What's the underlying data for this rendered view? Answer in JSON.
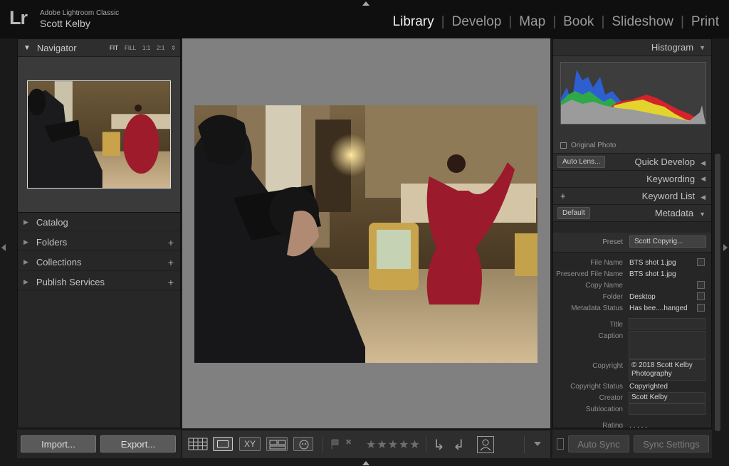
{
  "app": {
    "logo": "Lr",
    "name": "Adobe Lightroom Classic",
    "user": "Scott Kelby"
  },
  "modules": [
    {
      "label": "Library",
      "active": true
    },
    {
      "label": "Develop"
    },
    {
      "label": "Map"
    },
    {
      "label": "Book"
    },
    {
      "label": "Slideshow"
    },
    {
      "label": "Print"
    }
  ],
  "navigator": {
    "title": "Navigator",
    "options": [
      "FIT",
      "FILL",
      "1:1",
      "2:1"
    ],
    "selected": "FIT"
  },
  "left_panels": [
    {
      "label": "Catalog",
      "plus": ""
    },
    {
      "label": "Folders",
      "plus": "+"
    },
    {
      "label": "Collections",
      "plus": "+"
    },
    {
      "label": "Publish Services",
      "plus": "+"
    }
  ],
  "left_buttons": {
    "import": "Import...",
    "export": "Export..."
  },
  "right": {
    "histogram": "Histogram",
    "original_photo": "Original Photo",
    "quick_develop": "Quick Develop",
    "auto_lens": "Auto Lens...",
    "keywording": "Keywording",
    "keyword_list": "Keyword List",
    "metadata": "Metadata",
    "default": "Default",
    "preset_label": "Preset",
    "preset_value": "Scott Copyrig...",
    "fields": [
      {
        "label": "File Name",
        "value": "BTS shot 1.jpg"
      },
      {
        "label": "Preserved File Name",
        "value": "BTS shot 1.jpg"
      },
      {
        "label": "Copy Name",
        "value": ""
      },
      {
        "label": "Folder",
        "value": "Desktop"
      },
      {
        "label": "Metadata Status",
        "value": "Has bee....hanged"
      }
    ],
    "title_label": "Title",
    "caption_label": "Caption",
    "copyright_label": "Copyright",
    "copyright_value": "© 2018 Scott Kelby Photography",
    "copyright_status_label": "Copyright Status",
    "copyright_status_value": "Copyrighted",
    "creator_label": "Creator",
    "creator_value": "Scott Kelby",
    "sublocation_label": "Sublocation",
    "rating_label": "Rating",
    "rating_value": ". . . . ."
  },
  "right_buttons": {
    "auto_sync": "Auto Sync",
    "sync_settings": "Sync Settings"
  },
  "toolbar": {
    "xy": "XY",
    "stars": "★★★★★"
  }
}
